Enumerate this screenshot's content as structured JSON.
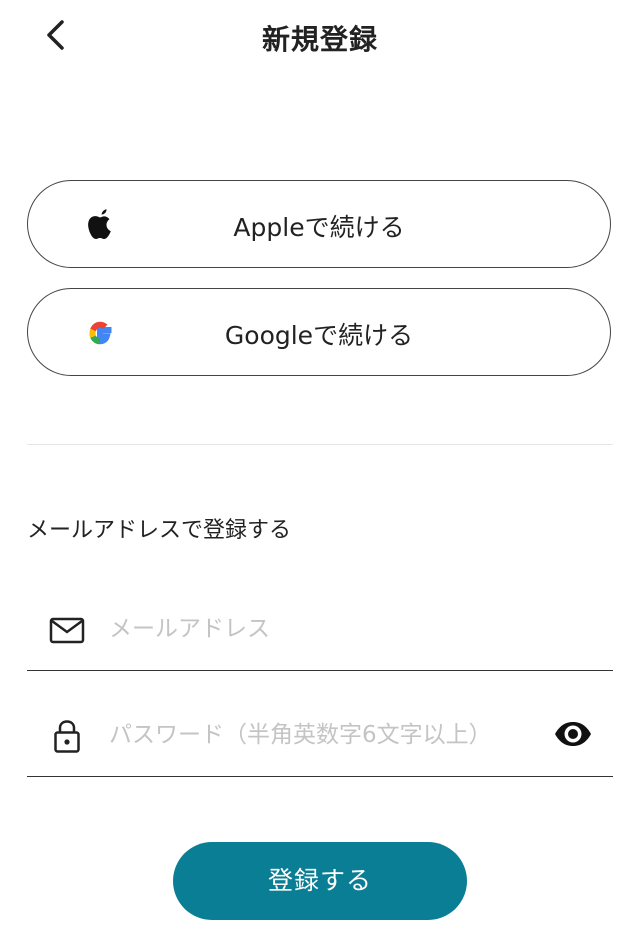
{
  "header": {
    "title": "新規登録",
    "back_icon": "chevron-left-icon"
  },
  "social": {
    "apple": {
      "label": "Appleで続ける",
      "icon": "apple-icon"
    },
    "google": {
      "label": "Googleで続ける",
      "icon": "google-icon"
    }
  },
  "email_section": {
    "label": "メールアドレスで登録する"
  },
  "form": {
    "email": {
      "placeholder": "メールアドレス",
      "value": "",
      "icon": "mail-icon"
    },
    "password": {
      "placeholder": "パスワード（半角英数字6文字以上）",
      "value": "",
      "icon": "lock-icon",
      "toggle_icon": "eye-icon"
    }
  },
  "submit": {
    "label": "登録する"
  },
  "colors": {
    "accent": "#0a7e94",
    "border": "#444444",
    "placeholder": "#c4c4c4"
  }
}
